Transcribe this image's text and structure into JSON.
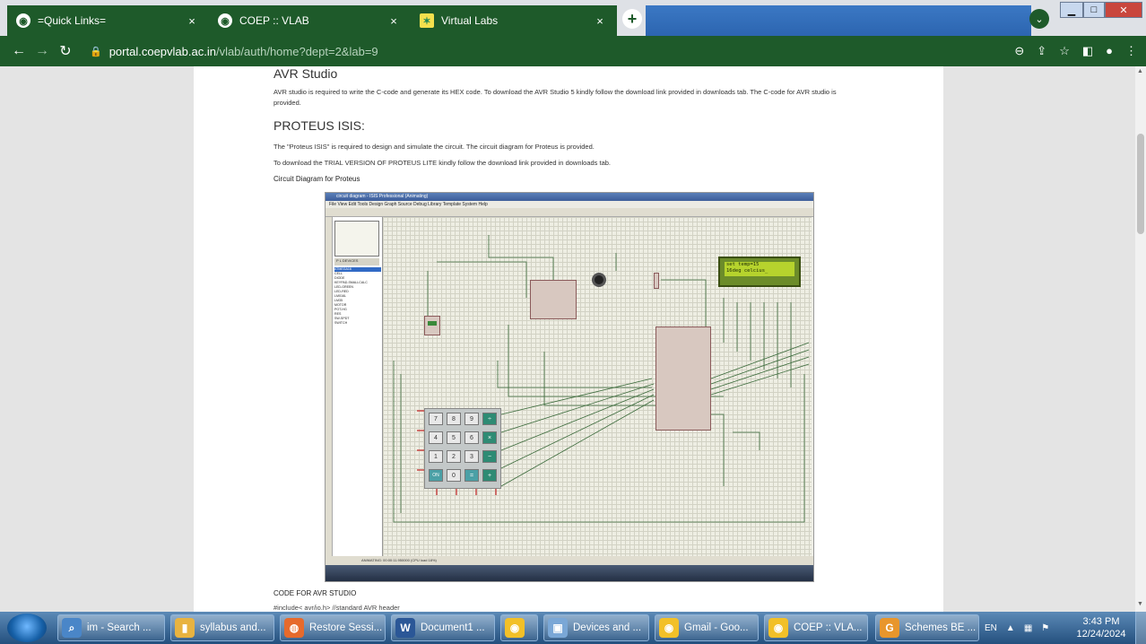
{
  "browser": {
    "tabs": [
      {
        "title": "=Quick Links=",
        "icon": "globe-icon"
      },
      {
        "title": "COEP :: VLAB",
        "icon": "globe-icon"
      },
      {
        "title": "Virtual Labs",
        "icon": "vlab-icon"
      }
    ],
    "close_glyph": "×",
    "new_tab_glyph": "+",
    "url_host": "portal.coepvlab.ac.in",
    "url_path": "/vlab/auth/home?dept=2&lab=9",
    "window_controls": {
      "min": "▁",
      "max": "□",
      "close": "✕"
    }
  },
  "page": {
    "avr_heading": "AVR Studio",
    "avr_text": "AVR studio is required to write the C-code and generate its HEX code. To download the AVR Studio 5 kindly follow the download link provided in downloads tab. The C-code for AVR studio is provided.",
    "proteus_heading": "PROTEUS ISIS:",
    "proteus_text_1": "The \"Proteus ISIS\" is required to design and simulate the circuit. The circuit diagram for Proteus is provided.",
    "proteus_text_2": "To download the TRIAL VERSION OF PROTEUS LITE kindly follow the download link provided in downloads tab.",
    "circuit_caption": "Circuit Diagram for Proteus",
    "code_heading": "CODE FOR AVR STUDIO",
    "code_first_line": "#include< avr/io.h> //standard AVR header"
  },
  "figure": {
    "title": "circuit diagram - ISIS Professional (Animating)",
    "menu": "File  View  Edit  Tools  Design  Graph  Source  Debug  Library  Template  System  Help",
    "pick_label": "P  L  DEVICES",
    "devices": [
      "ATMEGA16",
      "CELL",
      "DIODE",
      "KEYPAD-SMALLCALC",
      "LED-GREEN",
      "LED-RED",
      "LM016L",
      "LM35",
      "MOTOR",
      "POT-HG",
      "RES",
      "SW-SPDT",
      "SWITCH"
    ],
    "lcd_line_1": "set temp=15",
    "lcd_line_2": "16deg celcius_",
    "keys": [
      "7",
      "8",
      "9",
      "÷",
      "4",
      "5",
      "6",
      "×",
      "1",
      "2",
      "3",
      "−",
      "ON",
      "0",
      "=",
      "+"
    ],
    "status": "ANIMATING: 00:00:11.950000 (CPU load 18%)"
  },
  "taskbar": {
    "items": [
      {
        "label": "im - Search ...",
        "icon": "search-icon",
        "color": "#4a86c8"
      },
      {
        "label": "syllabus and...",
        "icon": "folder-icon",
        "color": "#e8b340"
      },
      {
        "label": "Restore Sessi...",
        "icon": "firefox-icon",
        "color": "#e66a2c"
      },
      {
        "label": "Document1 ...",
        "icon": "word-icon",
        "color": "#2b5797"
      },
      {
        "label": "",
        "icon": "chrome-icon",
        "color": "#f2c028"
      },
      {
        "label": "Devices and ...",
        "icon": "devices-icon",
        "color": "#7aa7d6"
      },
      {
        "label": "Gmail - Goo...",
        "icon": "chrome-icon",
        "color": "#f2c028"
      },
      {
        "label": "COEP :: VLA...",
        "icon": "chrome-icon",
        "color": "#f2c028"
      },
      {
        "label": "Schemes BE ...",
        "icon": "app-icon",
        "color": "#e8962c"
      }
    ],
    "tray_lang": "EN",
    "time": "3:43 PM",
    "date": "12/24/2024"
  }
}
